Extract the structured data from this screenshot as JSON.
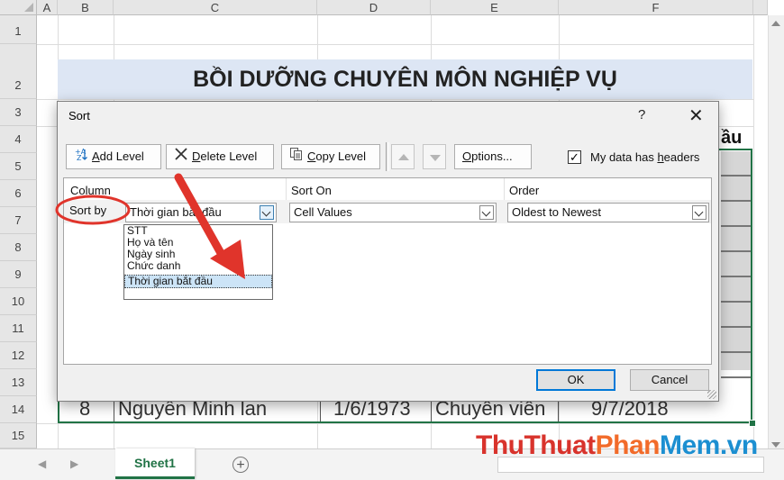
{
  "sheet": {
    "columns": [
      "A",
      "B",
      "C",
      "D",
      "E",
      "F"
    ],
    "rows": [
      "1",
      "2",
      "3",
      "4",
      "5",
      "6",
      "7",
      "8",
      "9",
      "10",
      "11",
      "12",
      "13",
      "14",
      "15"
    ],
    "title": "BỒI DƯỠNG CHUYÊN MÔN NGHIỆP VỤ",
    "header_partial": "ầu",
    "row14": {
      "stt": "8",
      "name": "Nguyễn Minh lan",
      "dob": "1/6/1973",
      "title": "Chuyên viên",
      "start": "9/7/2018"
    },
    "tab_name": "Sheet1",
    "add_sheet": "+",
    "nav_prev": "◀",
    "nav_next": "▶"
  },
  "dialog": {
    "title": "Sort",
    "help": "?",
    "close": "✕",
    "toolbar": {
      "add_level_u": "A",
      "add_level_rest": "dd Level",
      "delete_level_u": "D",
      "delete_level_rest": "elete Level",
      "copy_level_u": "C",
      "copy_level_rest": "opy Level",
      "options_u": "O",
      "options_rest": "ptions...",
      "headers_pre": "My data has ",
      "headers_u": "h",
      "headers_rest": "eaders",
      "headers_checked": "✓"
    },
    "columns": {
      "column": "Column",
      "sort_on": "Sort On",
      "order": "Order"
    },
    "row": {
      "label": "Sort by",
      "column_value": "Thời gian bắt đầu",
      "sort_on_value": "Cell Values",
      "order_value": "Oldest to Newest"
    },
    "dropdown_options": [
      "STT",
      "Họ và tên",
      "Ngày sinh",
      "Chức danh",
      "Thời gian bắt đầu"
    ],
    "ok": "OK",
    "cancel": "Cancel"
  },
  "watermark": {
    "part1": "ThuThuat",
    "part2": "Phan",
    "part3": "Mem.vn"
  },
  "colors": {
    "excel_green": "#217346",
    "annotation_red": "#e0342b",
    "focus_blue": "#0078d7"
  }
}
